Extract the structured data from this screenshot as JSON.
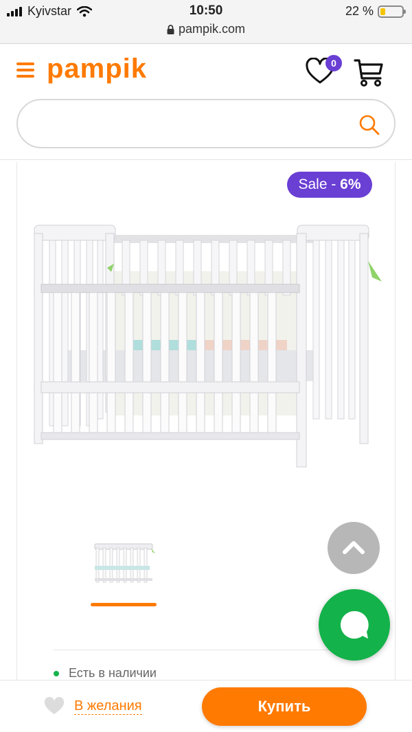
{
  "status_bar": {
    "carrier": "Kyivstar",
    "time": "10:50",
    "battery_percent": "22 %",
    "battery_level": 0.22,
    "url": "pampik.com"
  },
  "header": {
    "logo": "pampik",
    "wishlist_count": "0",
    "icons": [
      "menu-icon",
      "heart-icon",
      "cart-icon"
    ]
  },
  "search": {
    "placeholder": "",
    "value": ""
  },
  "product": {
    "sale_label": "Sale - ",
    "sale_value": "6%",
    "stock_status": "Есть в наличии"
  },
  "bottom_bar": {
    "wishlist_label": "В желания",
    "buy_label": "Купить"
  },
  "colors": {
    "brand_orange": "#ff7a00",
    "sale_purple": "#6a3fd4",
    "chat_green": "#13b24a",
    "stock_green": "#15b34a"
  }
}
